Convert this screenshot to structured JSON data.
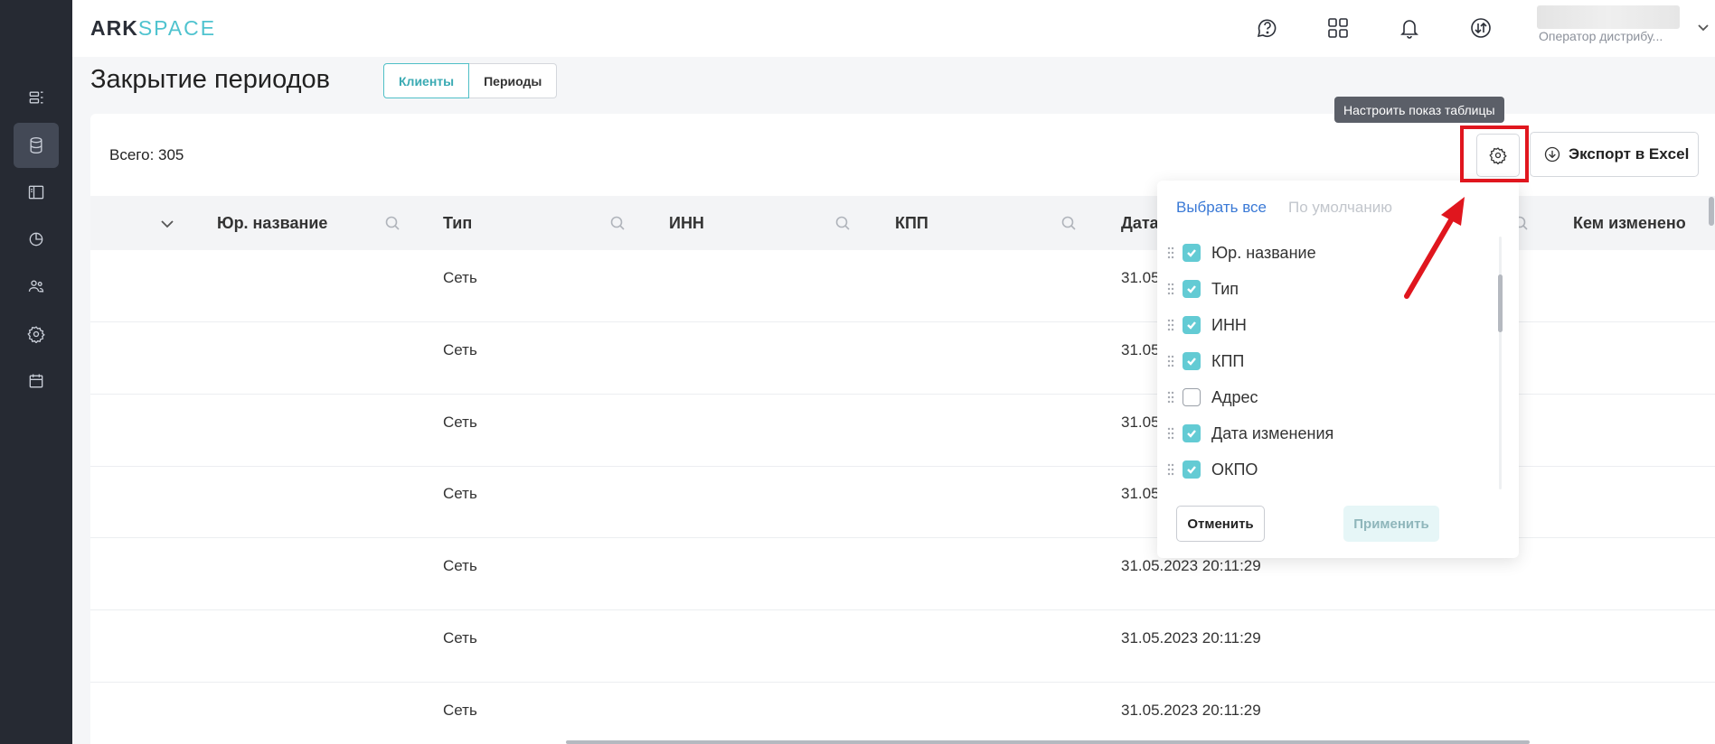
{
  "app": {
    "logo_ark": "ARK",
    "logo_space": "SPACE",
    "user_role": "Оператор дистрибу..."
  },
  "sidebar": {
    "items": [
      {
        "icon": "layout-list-icon",
        "active": false
      },
      {
        "icon": "database-icon",
        "active": true
      },
      {
        "icon": "sidebar-panel-icon",
        "active": false
      },
      {
        "icon": "pie-chart-icon",
        "active": false
      },
      {
        "icon": "users-icon",
        "active": false
      },
      {
        "icon": "gear-icon",
        "active": false
      },
      {
        "icon": "calendar-icon",
        "active": false
      }
    ]
  },
  "header_icons": [
    "help-chat-icon",
    "apps-grid-icon",
    "bell-icon",
    "sync-icon",
    "chevron-down-icon"
  ],
  "page": {
    "title": "Закрытие периодов",
    "tabs": [
      {
        "label": "Клиенты",
        "active": true
      },
      {
        "label": "Периоды",
        "active": false
      }
    ]
  },
  "toolbar": {
    "total": "Всего: 305",
    "settings_tooltip": "Настроить показ таблицы",
    "export_label": "Экспорт в Excel"
  },
  "table": {
    "columns": [
      "Юр. название",
      "Тип",
      "ИНН",
      "КПП",
      "Дата",
      "Кем изменено"
    ],
    "rows": [
      {
        "type": "Сеть",
        "date": "31.05"
      },
      {
        "type": "Сеть",
        "date": "31.05"
      },
      {
        "type": "Сеть",
        "date": "31.05"
      },
      {
        "type": "Сеть",
        "date": "31.05"
      },
      {
        "type": "Сеть",
        "date": "31.05.2023 20:11:29"
      },
      {
        "type": "Сеть",
        "date": "31.05.2023 20:11:29"
      },
      {
        "type": "Сеть",
        "date": "31.05.2023 20:11:29"
      }
    ]
  },
  "column_panel": {
    "select_all": "Выбрать все",
    "default": "По умолчанию",
    "items": [
      {
        "label": "Юр. название",
        "checked": true
      },
      {
        "label": "Тип",
        "checked": true
      },
      {
        "label": "ИНН",
        "checked": true
      },
      {
        "label": "КПП",
        "checked": true
      },
      {
        "label": "Адрес",
        "checked": false
      },
      {
        "label": "Дата изменения",
        "checked": true
      },
      {
        "label": "ОКПО",
        "checked": true
      }
    ],
    "cancel": "Отменить",
    "apply": "Применить"
  },
  "colors": {
    "accent": "#4fbfc7",
    "sidebar_bg": "#262a33",
    "highlight_red": "#e0161e",
    "link_blue": "#3a79d6"
  }
}
